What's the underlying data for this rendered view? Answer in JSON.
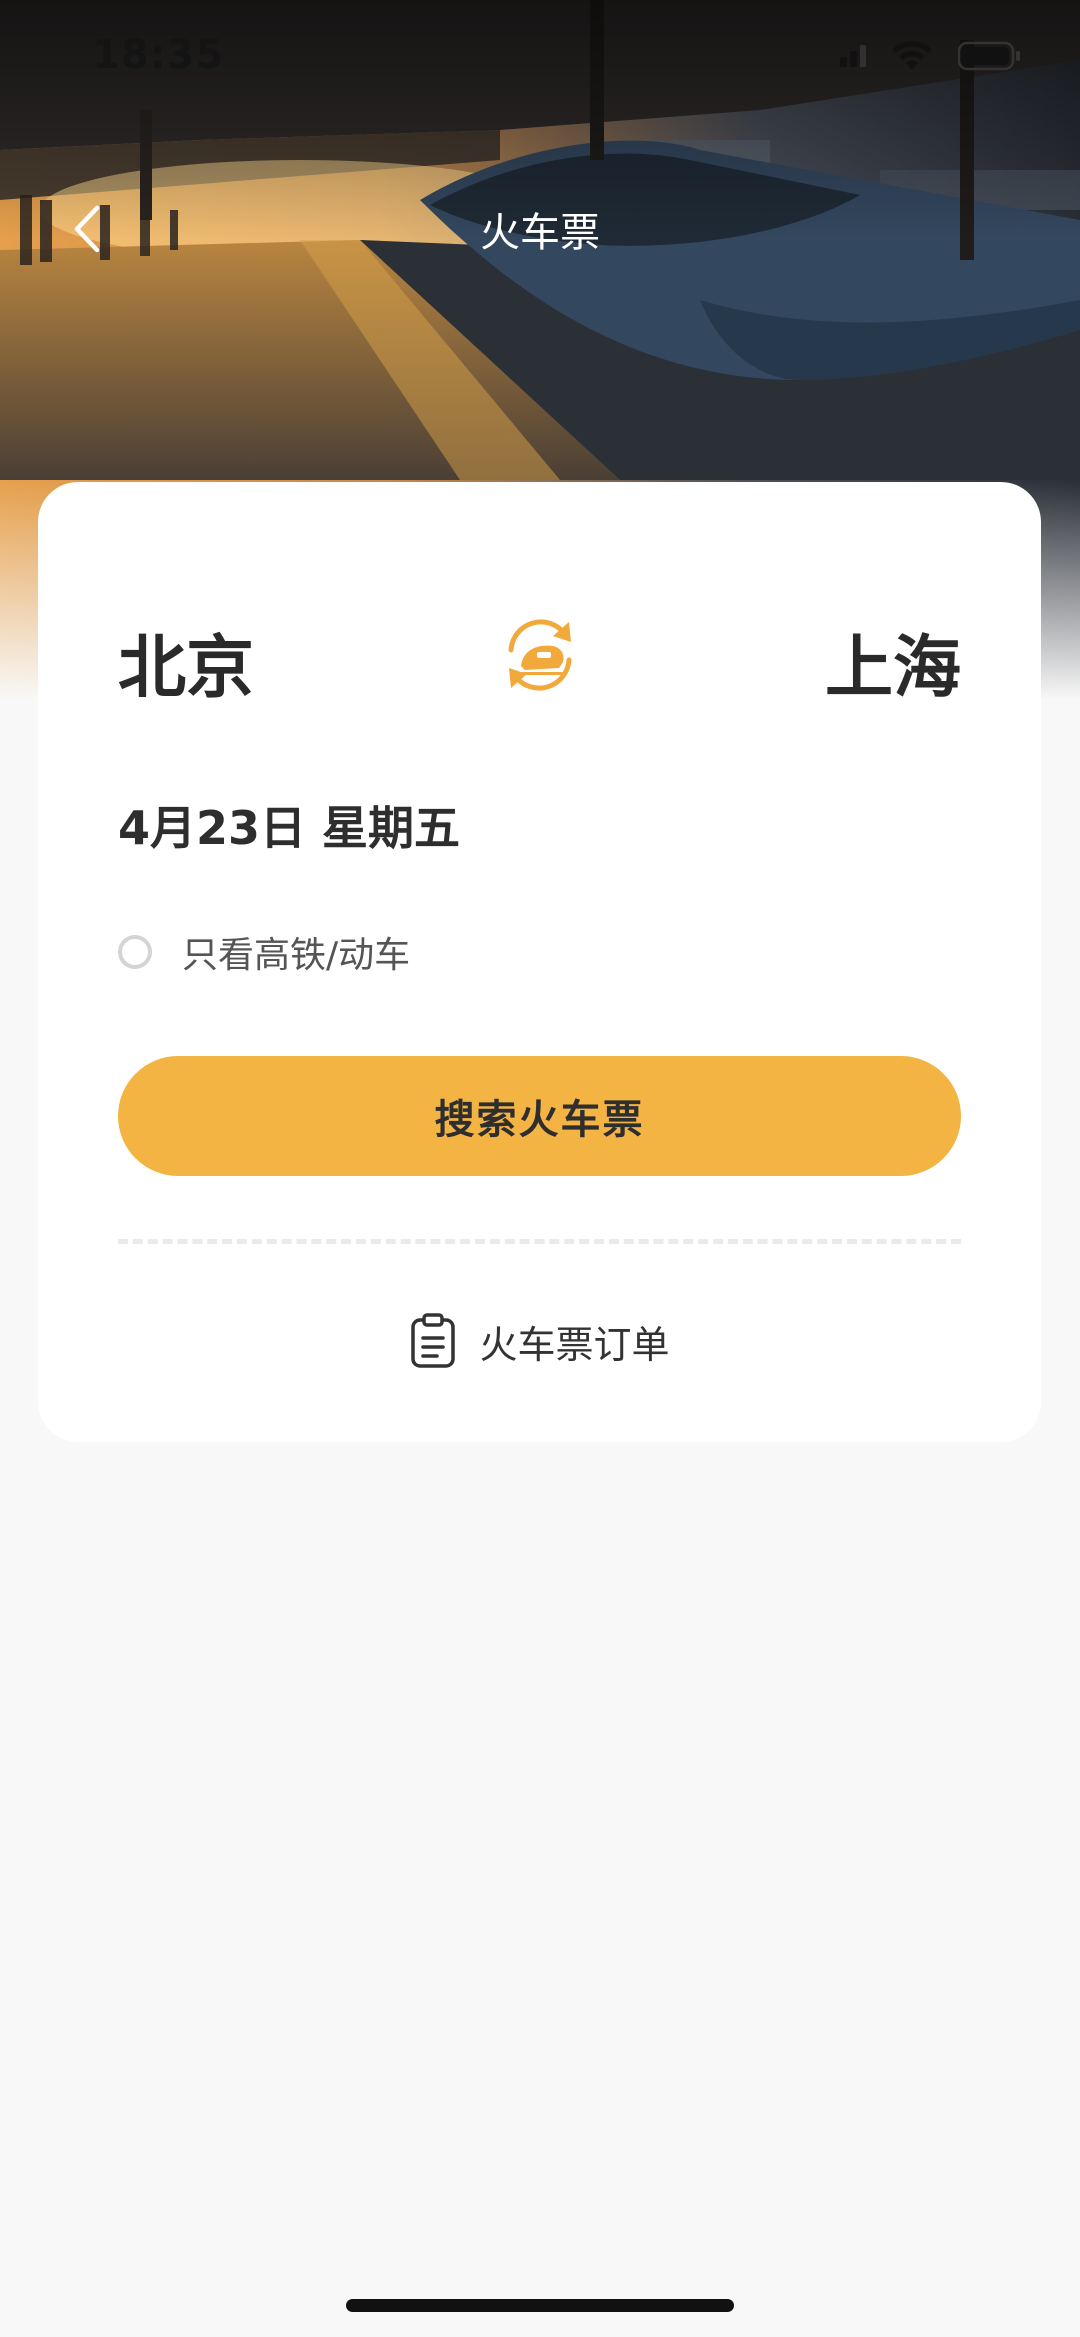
{
  "status_bar": {
    "time": "18:35"
  },
  "header": {
    "title": "火车票",
    "back_icon": "chevron-left-icon"
  },
  "route": {
    "from": "北京",
    "to": "上海",
    "swap_icon": "swap-train-icon"
  },
  "date": {
    "text": "4月23日 星期五"
  },
  "filter": {
    "label": "只看高铁/动车",
    "checked": false
  },
  "search": {
    "label": "搜索火车票"
  },
  "orders": {
    "label": "火车票订单",
    "icon": "clipboard-icon"
  },
  "colors": {
    "accent": "#f4b443",
    "page_background": "#f8f8f8",
    "card_background": "#ffffff",
    "text_primary": "#2a2a2a"
  }
}
